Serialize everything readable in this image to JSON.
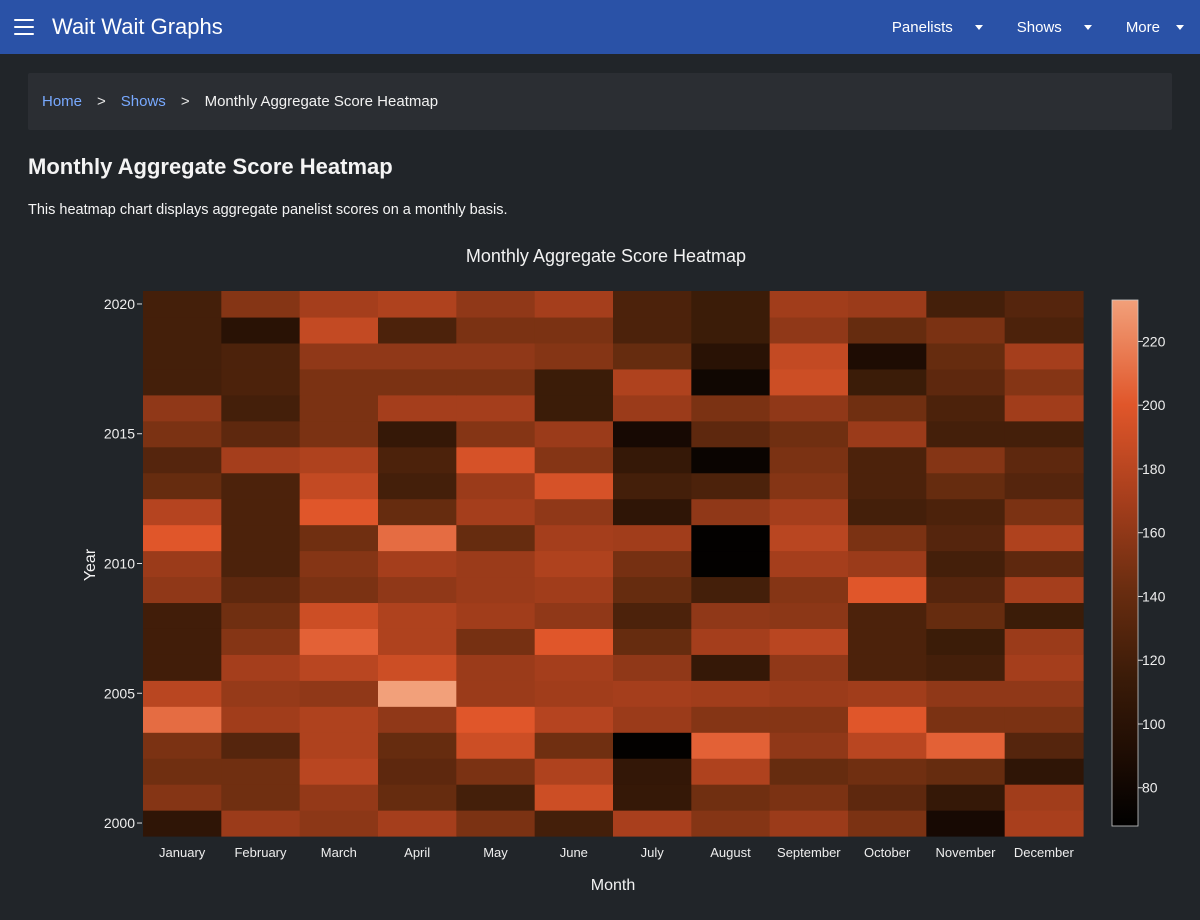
{
  "navbar": {
    "brand": "Wait Wait Graphs",
    "items": [
      {
        "label": "Panelists"
      },
      {
        "label": "Shows"
      },
      {
        "label": "More"
      }
    ]
  },
  "breadcrumb": {
    "home": "Home",
    "separator": ">",
    "shows": "Shows",
    "current": "Monthly Aggregate Score Heatmap"
  },
  "page": {
    "title": "Monthly Aggregate Score Heatmap",
    "description": "This heatmap chart displays aggregate panelist scores on a monthly basis."
  },
  "chart_data": {
    "type": "heatmap",
    "title": "Monthly Aggregate Score Heatmap",
    "xlabel": "Month",
    "ylabel": "Year",
    "categories": [
      "January",
      "February",
      "March",
      "April",
      "May",
      "June",
      "July",
      "August",
      "September",
      "October",
      "November",
      "December"
    ],
    "years": [
      2000,
      2001,
      2002,
      2003,
      2004,
      2005,
      2006,
      2007,
      2008,
      2009,
      2010,
      2011,
      2012,
      2013,
      2014,
      2015,
      2016,
      2017,
      2018,
      2019,
      2020
    ],
    "ytick_values": [
      2000,
      2005,
      2010,
      2015,
      2020
    ],
    "zmin": 68,
    "zmax": 233,
    "colorbar_ticks": [
      80,
      100,
      120,
      140,
      160,
      180,
      200,
      220
    ],
    "values": [
      [
        105,
        165,
        158,
        170,
        150,
        120,
        172,
        155,
        165,
        150,
        85,
        172
      ],
      [
        155,
        145,
        162,
        140,
        120,
        190,
        110,
        145,
        150,
        135,
        110,
        168
      ],
      [
        145,
        145,
        180,
        135,
        150,
        175,
        108,
        175,
        140,
        145,
        140,
        105
      ],
      [
        150,
        130,
        175,
        140,
        190,
        145,
        70,
        205,
        160,
        180,
        205,
        130
      ],
      [
        210,
        168,
        175,
        160,
        200,
        178,
        165,
        155,
        155,
        200,
        150,
        150
      ],
      [
        180,
        163,
        160,
        233,
        165,
        168,
        170,
        168,
        165,
        168,
        160,
        160
      ],
      [
        118,
        170,
        180,
        190,
        165,
        170,
        160,
        110,
        160,
        125,
        120,
        170
      ],
      [
        118,
        155,
        205,
        175,
        148,
        200,
        140,
        170,
        180,
        125,
        115,
        165
      ],
      [
        118,
        145,
        190,
        175,
        168,
        160,
        125,
        160,
        158,
        125,
        140,
        115
      ],
      [
        160,
        135,
        150,
        160,
        165,
        168,
        140,
        120,
        155,
        200,
        130,
        170
      ],
      [
        165,
        125,
        155,
        170,
        165,
        175,
        148,
        70,
        170,
        165,
        120,
        135
      ],
      [
        200,
        125,
        145,
        210,
        140,
        170,
        168,
        70,
        180,
        150,
        130,
        175
      ],
      [
        178,
        125,
        200,
        140,
        170,
        160,
        105,
        160,
        170,
        120,
        125,
        150
      ],
      [
        140,
        125,
        185,
        120,
        165,
        195,
        120,
        125,
        155,
        125,
        140,
        130
      ],
      [
        130,
        170,
        175,
        125,
        195,
        155,
        110,
        75,
        150,
        125,
        155,
        135
      ],
      [
        150,
        135,
        150,
        110,
        155,
        165,
        85,
        135,
        145,
        165,
        120,
        120
      ],
      [
        160,
        120,
        150,
        170,
        170,
        115,
        165,
        150,
        160,
        145,
        125,
        168
      ],
      [
        120,
        125,
        150,
        150,
        150,
        115,
        175,
        80,
        190,
        115,
        135,
        155
      ],
      [
        120,
        125,
        160,
        160,
        160,
        155,
        140,
        100,
        185,
        90,
        140,
        170
      ],
      [
        120,
        100,
        185,
        125,
        150,
        150,
        125,
        115,
        160,
        140,
        150,
        125
      ],
      [
        120,
        155,
        170,
        175,
        160,
        170,
        125,
        115,
        168,
        165,
        120,
        130
      ]
    ]
  }
}
